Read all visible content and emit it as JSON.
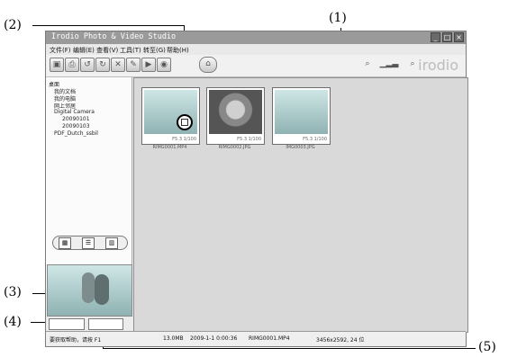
{
  "callouts": {
    "c1": "(1)",
    "c2": "(2)",
    "c3": "(3)",
    "c4": "(4)",
    "c5": "(5)"
  },
  "window": {
    "title": "Irodio Photo & Video Studio",
    "controls": [
      "_",
      "□",
      "×"
    ],
    "menu": [
      "文件(F)",
      "编辑(E)",
      "查看(V)",
      "工具(T)",
      "转至(G)",
      "帮助(H)"
    ],
    "brand": "irodio",
    "toolbar_icons": [
      "open-icon",
      "print-icon",
      "rotate-left-icon",
      "rotate-right-icon",
      "delete-icon",
      "edit-icon",
      "slideshow-icon",
      "view-icon",
      "home-icon",
      "search-icon",
      "zoom-slider-icon",
      "zoom-icon"
    ]
  },
  "tree": [
    "桌面",
    "我的文档",
    "我的电脑",
    "网上邻居",
    "Digital Camera",
    "20090101",
    "20090103",
    "PDF_Dutch_ssbil"
  ],
  "thumbnails": [
    {
      "name": "RIMG0001.MP4",
      "meta": "F5.3 1/100"
    },
    {
      "name": "RIMG0002.JPG",
      "meta": "F5.3 1/100"
    },
    {
      "name": "IMG0003.JPG",
      "meta": "F5.3 1/100"
    }
  ],
  "status": {
    "help": "要获取帮助，请按 F1",
    "size": "13.0MB",
    "date": "2009-1-1 0:00:36",
    "file": "RIMG0001.MP4",
    "dimensions": "3456x2592, 24 位"
  }
}
